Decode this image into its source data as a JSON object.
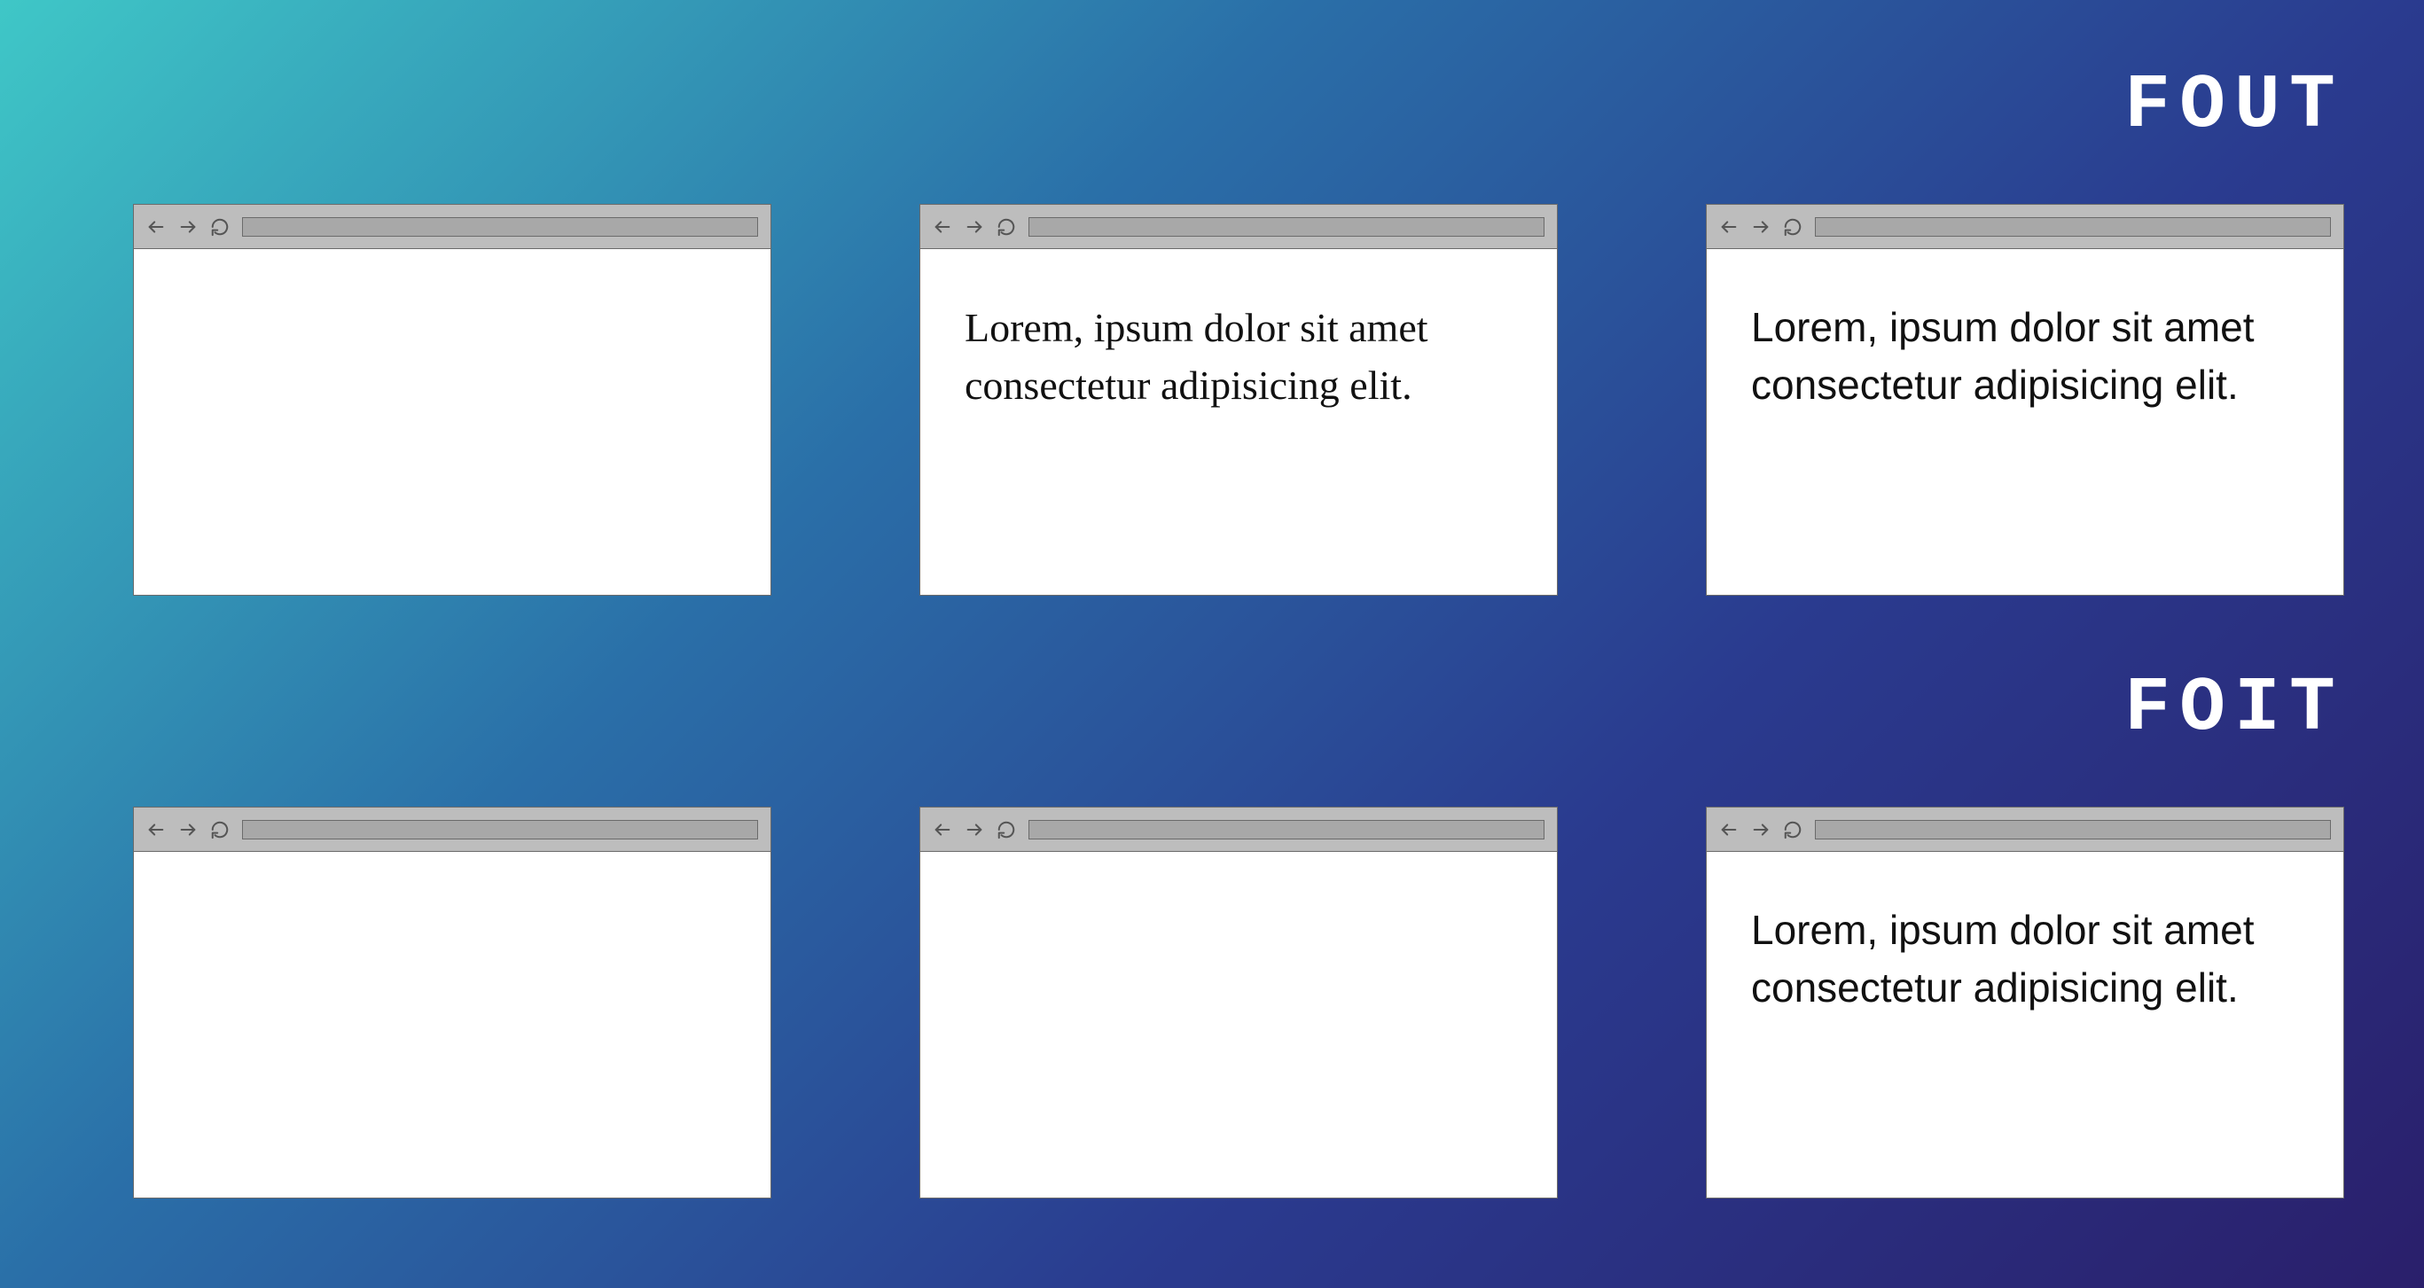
{
  "labels": {
    "fout": "FOUT",
    "foit": "FOIT"
  },
  "sample_text": "Lorem, ipsum dolor sit amet consectetur adipisicing elit.",
  "rows": {
    "fout": [
      {
        "text": "",
        "font": "none"
      },
      {
        "text": "Lorem, ipsum dolor sit amet consectetur adipisicing elit.",
        "font": "serif"
      },
      {
        "text": "Lorem, ipsum dolor sit amet consectetur adipisicing elit.",
        "font": "sans"
      }
    ],
    "foit": [
      {
        "text": "",
        "font": "none"
      },
      {
        "text": "",
        "font": "none"
      },
      {
        "text": "Lorem, ipsum dolor sit amet consectetur adipisicing elit.",
        "font": "sans"
      }
    ]
  },
  "icons": {
    "back": "arrow-left-icon",
    "forward": "arrow-right-icon",
    "reload": "reload-icon"
  }
}
